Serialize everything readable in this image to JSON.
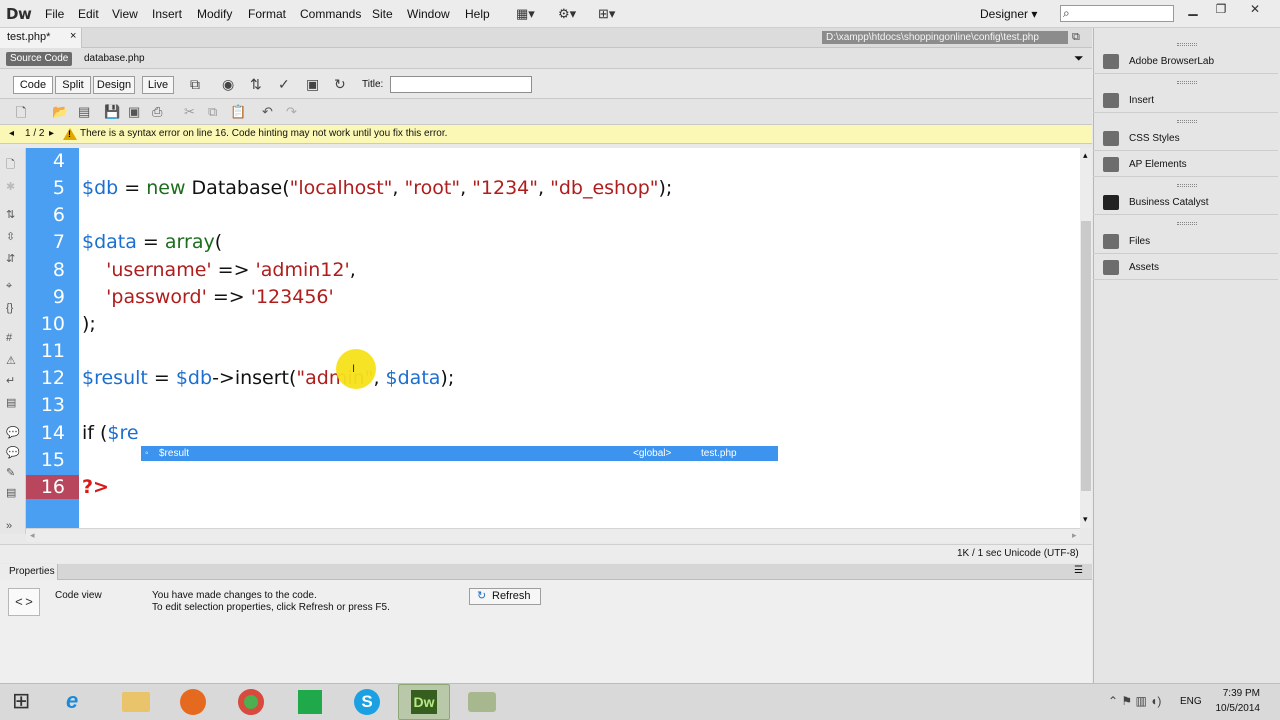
{
  "app": {
    "logo": "Dw"
  },
  "menu": [
    "File",
    "Edit",
    "View",
    "Insert",
    "Modify",
    "Format",
    "Commands",
    "Site",
    "Window",
    "Help"
  ],
  "workspace": "Designer",
  "doc": {
    "active_tab": "test.php*",
    "close": "×",
    "path": "D:\\xampp\\htdocs\\shoppingonline\\config\\test.php",
    "source_code": "Source Code",
    "related_file": "database.php"
  },
  "view_buttons": [
    "Code",
    "Split",
    "Design",
    "Live"
  ],
  "title_label": "Title:",
  "title_value": "",
  "error": {
    "counter": "1 / 2",
    "message": "There is a syntax error on line 16.  Code hinting may not work until you fix this error."
  },
  "code_lines": [
    {
      "n": "4",
      "parts": []
    },
    {
      "n": "5",
      "parts": [
        [
          "var",
          "$db"
        ],
        [
          "txt",
          " = "
        ],
        [
          "kw",
          "new"
        ],
        [
          "txt",
          " Database("
        ],
        [
          "str",
          "\"localhost\""
        ],
        [
          "txt",
          ", "
        ],
        [
          "str",
          "\"root\""
        ],
        [
          "txt",
          ", "
        ],
        [
          "str",
          "\"1234\""
        ],
        [
          "txt",
          ", "
        ],
        [
          "str",
          "\"db_eshop\""
        ],
        [
          "txt",
          ");"
        ]
      ]
    },
    {
      "n": "6",
      "parts": []
    },
    {
      "n": "7",
      "parts": [
        [
          "var",
          "$data"
        ],
        [
          "txt",
          " = "
        ],
        [
          "kw",
          "array"
        ],
        [
          "txt",
          "("
        ]
      ]
    },
    {
      "n": "8",
      "parts": [
        [
          "txt",
          "    "
        ],
        [
          "str",
          "'username'"
        ],
        [
          "txt",
          " => "
        ],
        [
          "str",
          "'admin12'"
        ],
        [
          "txt",
          ","
        ]
      ]
    },
    {
      "n": "9",
      "parts": [
        [
          "txt",
          "    "
        ],
        [
          "str",
          "'password'"
        ],
        [
          "txt",
          " => "
        ],
        [
          "str",
          "'123456'"
        ]
      ]
    },
    {
      "n": "10",
      "parts": [
        [
          "txt",
          ");"
        ]
      ]
    },
    {
      "n": "11",
      "parts": []
    },
    {
      "n": "12",
      "parts": [
        [
          "var",
          "$result"
        ],
        [
          "txt",
          " = "
        ],
        [
          "var",
          "$db"
        ],
        [
          "txt",
          "->insert("
        ],
        [
          "str",
          "\"admin\""
        ],
        [
          "txt",
          ", "
        ],
        [
          "var",
          "$data"
        ],
        [
          "txt",
          ");"
        ]
      ]
    },
    {
      "n": "13",
      "parts": []
    },
    {
      "n": "14",
      "parts": [
        [
          "txt",
          "if ("
        ],
        [
          "var",
          "$re"
        ]
      ]
    },
    {
      "n": "15",
      "parts": []
    },
    {
      "n": "16",
      "parts": [
        [
          "php",
          "?>"
        ]
      ],
      "error": true
    }
  ],
  "hint": {
    "name": "$result",
    "scope": "<global>",
    "file": "test.php"
  },
  "status": "1K / 1 sec  Unicode (UTF-8)",
  "properties": {
    "tab": "Properties",
    "icon": "< >",
    "view": "Code view",
    "msg1": "You have made changes to the code.",
    "msg2": "To edit selection properties, click Refresh or press F5.",
    "refresh": "Refresh"
  },
  "panels": [
    "Adobe BrowserLab",
    "Insert",
    "CSS Styles",
    "AP Elements",
    "Business Catalyst",
    "Files",
    "Assets"
  ],
  "tray": {
    "lang": "ENG",
    "time": "7:39 PM",
    "date": "10/5/2014"
  },
  "colors": {
    "gutter": "#4a9ff2",
    "error_line": "#b8475d",
    "error_bar": "#fbf8b5",
    "hint": "#3d94ef",
    "variable": "#1b6fd0",
    "string": "#b01d1d"
  }
}
